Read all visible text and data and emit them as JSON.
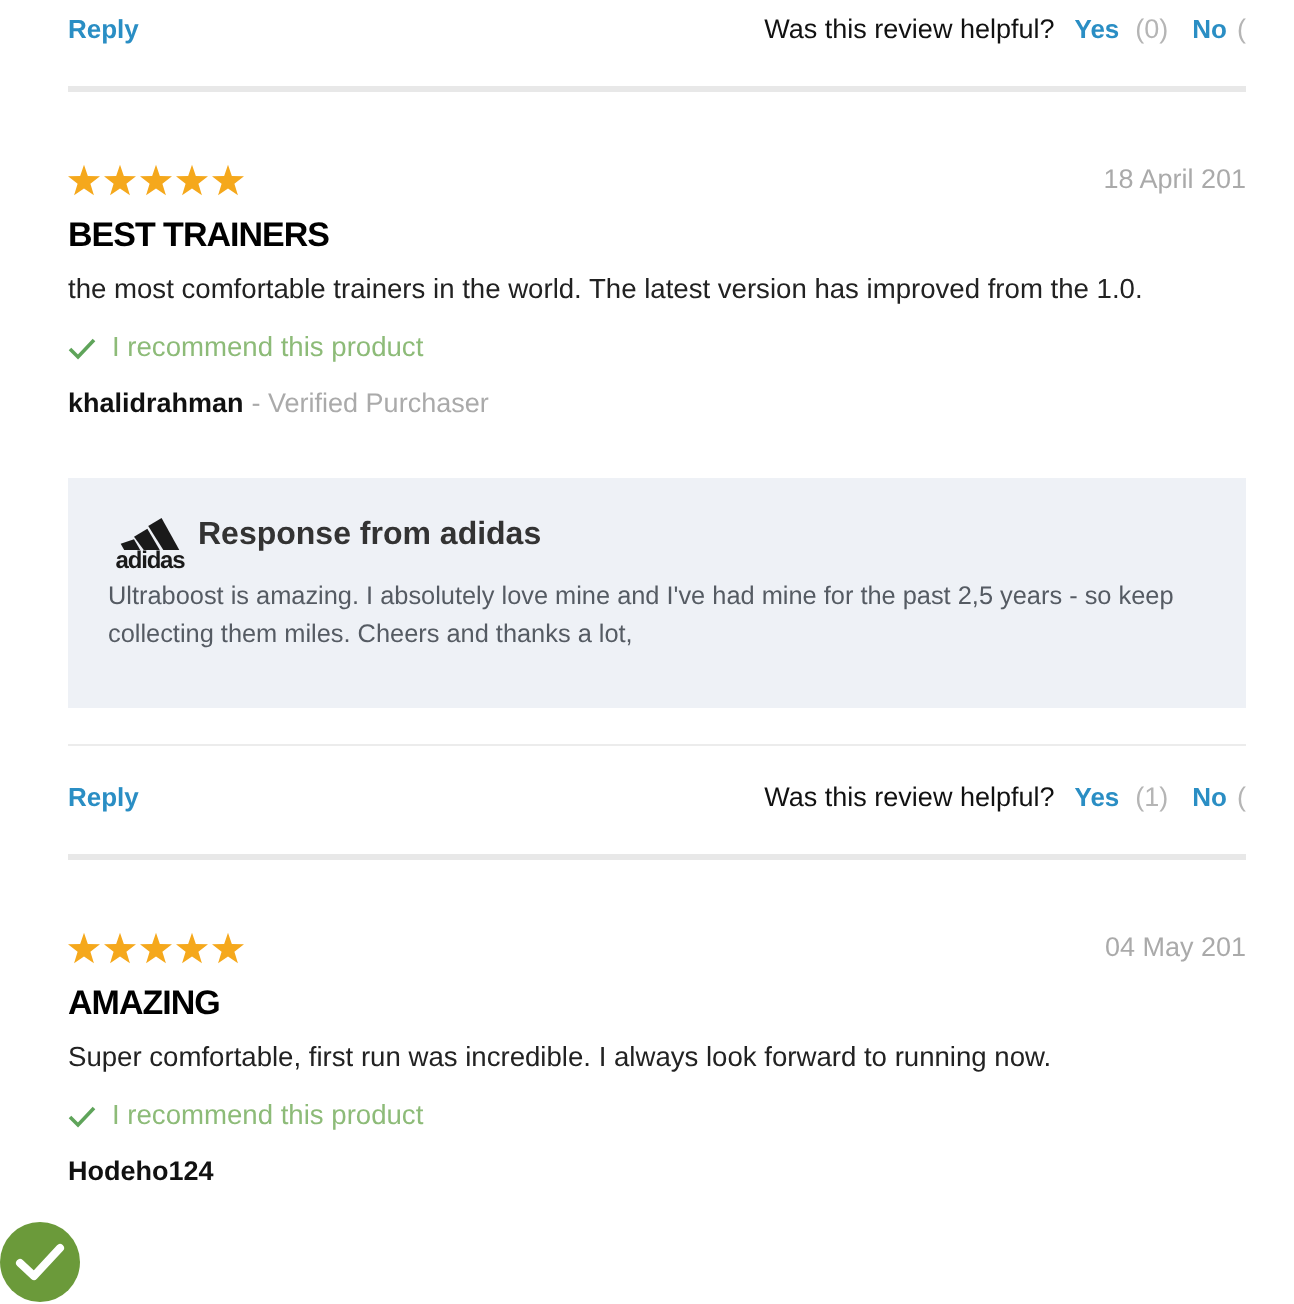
{
  "previous_review_footer": {
    "reply": "Reply",
    "helpful_question": "Was this review helpful?",
    "yes": "Yes",
    "yes_count": "(0)",
    "no": "No",
    "no_count": "("
  },
  "reviews": [
    {
      "stars": 5,
      "date": "18 April 201",
      "title": "BEST TRAINERS",
      "body": "the most comfortable trainers in the world. The latest version has improved from the 1.0.",
      "recommended": true,
      "recommend_text": "I recommend this product",
      "author": "khalidrahman",
      "author_note": "- Verified Purchaser",
      "response": {
        "logo_text": "adidas",
        "heading": "Response from adidas",
        "body": "Ultraboost is amazing. I absolutely love mine and I've had mine for the past 2,5 years - so keep collecting them miles. Cheers and thanks a lot,"
      },
      "footer": {
        "reply": "Reply",
        "helpful_question": "Was this review helpful?",
        "yes": "Yes",
        "yes_count": "(1)",
        "no": "No",
        "no_count": "("
      }
    },
    {
      "stars": 5,
      "date": "04 May 201",
      "title": "AMAZING",
      "body": "Super comfortable, first run was incredible. I always look forward to running now.",
      "recommended": true,
      "recommend_text": "I recommend this product",
      "author": "Hodeho124"
    }
  ]
}
